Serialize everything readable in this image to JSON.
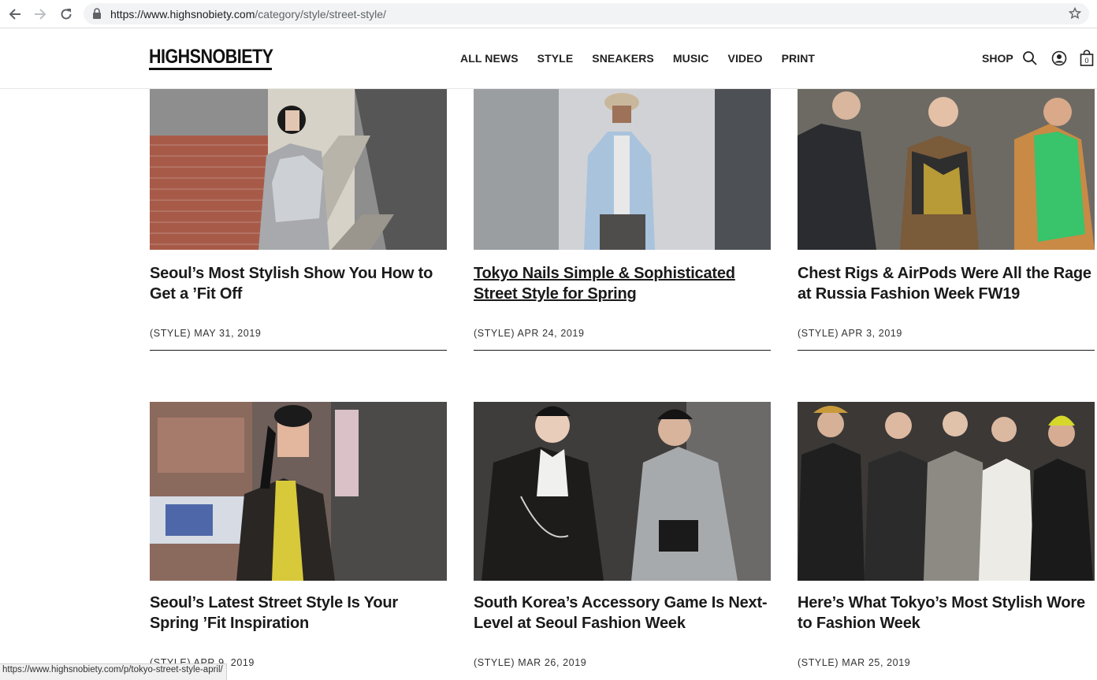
{
  "browser": {
    "url_host": "https://www.highsnobiety.com",
    "url_path": "/category/style/street-style/",
    "status_url": "https://www.highsnobiety.com/p/tokyo-street-style-april/"
  },
  "site": {
    "logo": "HIGHSNOBIETY",
    "nav": [
      "ALL NEWS",
      "STYLE",
      "SNEAKERS",
      "MUSIC",
      "VIDEO",
      "PRINT"
    ],
    "shop": "SHOP",
    "cart_count": "0"
  },
  "articles": [
    {
      "title": "Seoul’s Most Stylish Show You How to Get a ’Fit Off",
      "meta": "(STYLE) MAY 31, 2019"
    },
    {
      "title": "Tokyo Nails Simple & Sophisticated Street Style for Spring",
      "meta": "(STYLE) APR 24, 2019"
    },
    {
      "title": "Chest Rigs & AirPods Were All the Rage at Russia Fashion Week FW19",
      "meta": "(STYLE) APR 3, 2019"
    },
    {
      "title": "Seoul’s Latest Street Style Is Your Spring ’Fit Inspiration",
      "meta": "(STYLE) APR 9, 2019"
    },
    {
      "title": "South Korea’s Accessory Game Is Next-Level at Seoul Fashion Week",
      "meta": "(STYLE) MAR 26, 2019"
    },
    {
      "title": "Here’s What Tokyo’s Most Stylish Wore to Fashion Week",
      "meta": "(STYLE) MAR 25, 2019"
    }
  ]
}
